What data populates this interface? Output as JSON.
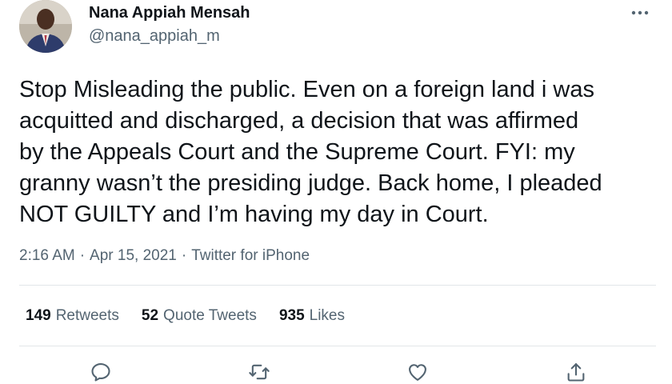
{
  "tweet": {
    "author_name": "Nana Appiah Mensah",
    "handle": "@nana_appiah_m",
    "text": "Stop Misleading the public. Even on a foreign land i was\nacquitted and discharged, a decision that was affirmed\nby the Appeals Court and the Supreme Court. FYI: my\ngranny wasn’t the presiding judge. Back home, I pleaded\nNOT GUILTY and I’m having my day in Court.",
    "time": "2:16 AM",
    "date": "Apr 15, 2021",
    "source": "Twitter for iPhone",
    "separator": "·"
  },
  "stats": {
    "retweets_count": "149",
    "retweets_label": "Retweets",
    "quotes_count": "52",
    "quotes_label": "Quote Tweets",
    "likes_count": "935",
    "likes_label": "Likes"
  },
  "icons": {
    "more": "more-horizontal-icon",
    "reply": "reply-icon",
    "retweet": "retweet-icon",
    "like": "like-icon",
    "share": "share-icon"
  },
  "colors": {
    "text": "#0f1419",
    "secondary": "#536471",
    "divider": "#e2e6e9"
  }
}
